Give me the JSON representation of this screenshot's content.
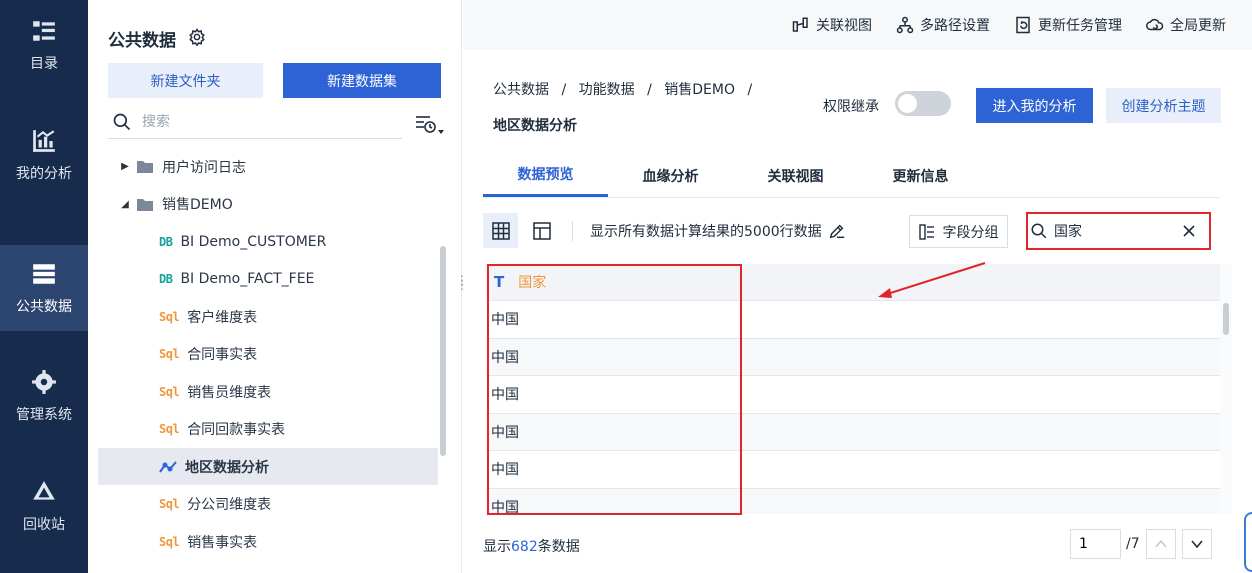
{
  "nav": [
    {
      "label": "目录",
      "icon": "catalog-icon"
    },
    {
      "label": "我的分析",
      "icon": "analysis-icon"
    },
    {
      "label": "公共数据",
      "icon": "public-data-icon",
      "active": true
    },
    {
      "label": "管理系统",
      "icon": "gear-icon"
    },
    {
      "label": "回收站",
      "icon": "recycle-icon"
    }
  ],
  "sidebar": {
    "title": "公共数据",
    "new_folder": "新建文件夹",
    "new_dataset": "新建数据集",
    "search_placeholder": "搜索",
    "tree": [
      {
        "label": "用户访问日志",
        "type": "folder",
        "arrow": "▶",
        "level": 0
      },
      {
        "label": "销售DEMO",
        "type": "folder",
        "arrow": "◢",
        "level": 0
      },
      {
        "label": "BI Demo_CUSTOMER",
        "type": "db",
        "level": 1
      },
      {
        "label": "BI Demo_FACT_FEE",
        "type": "db",
        "level": 1
      },
      {
        "label": "客户维度表",
        "type": "sql",
        "level": 1
      },
      {
        "label": "合同事实表",
        "type": "sql",
        "level": 1
      },
      {
        "label": "销售员维度表",
        "type": "sql",
        "level": 1
      },
      {
        "label": "合同回款事实表",
        "type": "sql",
        "level": 1
      },
      {
        "label": "地区数据分析",
        "type": "analysis",
        "level": 1,
        "selected": true
      },
      {
        "label": "分公司维度表",
        "type": "sql",
        "level": 1
      },
      {
        "label": "销售事实表",
        "type": "sql",
        "level": 1
      }
    ]
  },
  "topbar": {
    "related_view": "关联视图",
    "multipath": "多路径设置",
    "task_mgmt": "更新任务管理",
    "global_update": "全局更新"
  },
  "breadcrumb": {
    "items": [
      "公共数据",
      "/",
      "功能数据",
      "/",
      "销售DEMO",
      "/"
    ],
    "current": "地区数据分析"
  },
  "actions": {
    "perm_label": "权限继承",
    "perm_on": false,
    "enter_analysis": "进入我的分析",
    "create_theme": "创建分析主题"
  },
  "tabs": [
    "数据预览",
    "血缘分析",
    "关联视图",
    "更新信息"
  ],
  "toolbar": {
    "info": "显示所有数据计算结果的5000行数据",
    "field_group": "字段分组",
    "search_value": "国家"
  },
  "grid": {
    "type_icon": "T",
    "column": "国家",
    "rows": [
      "中国",
      "中国",
      "中国",
      "中国",
      "中国",
      "中国"
    ]
  },
  "footer": {
    "prefix": "显示",
    "count": "682",
    "suffix": "条数据",
    "page": "1",
    "total": "/7"
  },
  "colors": {
    "nav_bg": "#172b4d",
    "primary": "#2e63d6",
    "highlight": "#e0252b",
    "field_text": "#f0973b"
  }
}
